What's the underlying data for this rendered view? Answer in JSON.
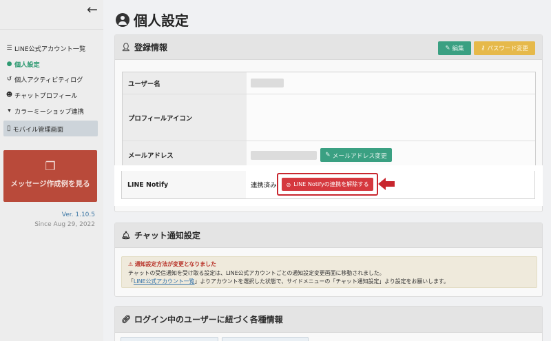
{
  "sidebar": {
    "items": [
      {
        "icon": "list-icon",
        "glyph": "☰",
        "label": "LINE公式アカウント一覧",
        "active": false
      },
      {
        "icon": "user-gear-icon",
        "glyph": "👤",
        "label": "個人設定",
        "active": true
      },
      {
        "icon": "history-icon",
        "glyph": "↺",
        "label": "個人アクティビティログ",
        "active": false
      },
      {
        "icon": "smile-icon",
        "glyph": "☻",
        "label": "チャットプロフィール",
        "active": false
      },
      {
        "icon": "cart-icon",
        "glyph": "🛒",
        "label": "カラーミーショップ連携",
        "active": false
      }
    ],
    "mobile_label": "モバイル管理画面",
    "message_button_label": "メッセージ作成例を見る",
    "version": "Ver. 1.10.5",
    "since": "Since Aug 29, 2022"
  },
  "page": {
    "title": "個人設定"
  },
  "registration": {
    "heading": "登録情報",
    "edit_label": "編集",
    "password_label": "パスワード変更",
    "rows": {
      "username_label": "ユーザー名",
      "icon_label": "プロフィールアイコン",
      "email_label": "メールアドレス",
      "email_button_label": "メールアドレス変更",
      "line_notify_label": "LINE Notify",
      "line_notify_status": "連携済み",
      "unlink_button_label": "LINE Notifyの連携を解除する"
    }
  },
  "chat_notify": {
    "heading": "チャット通知設定",
    "alert_title": "通知設定方法が変更となりました",
    "alert_line1": "チャットの受信通知を受け取る設定は、LINE公式アカウントごとの通知設定変更画面に移動されました。",
    "alert_line2_pre": "「",
    "alert_link": "LINE公式アカウント一覧",
    "alert_line2_post": "」よりアカウントを選択した状態で、サイドメニューの「チャット通知設定」より設定をお願いします。"
  },
  "login_info": {
    "heading": "ログイン中のユーザーに紐づく各種情報"
  },
  "colors": {
    "accent_green": "#3aa082",
    "warning_yellow": "#e6b94a",
    "danger_red": "#d5383e",
    "highlight_red": "#c8262e"
  }
}
